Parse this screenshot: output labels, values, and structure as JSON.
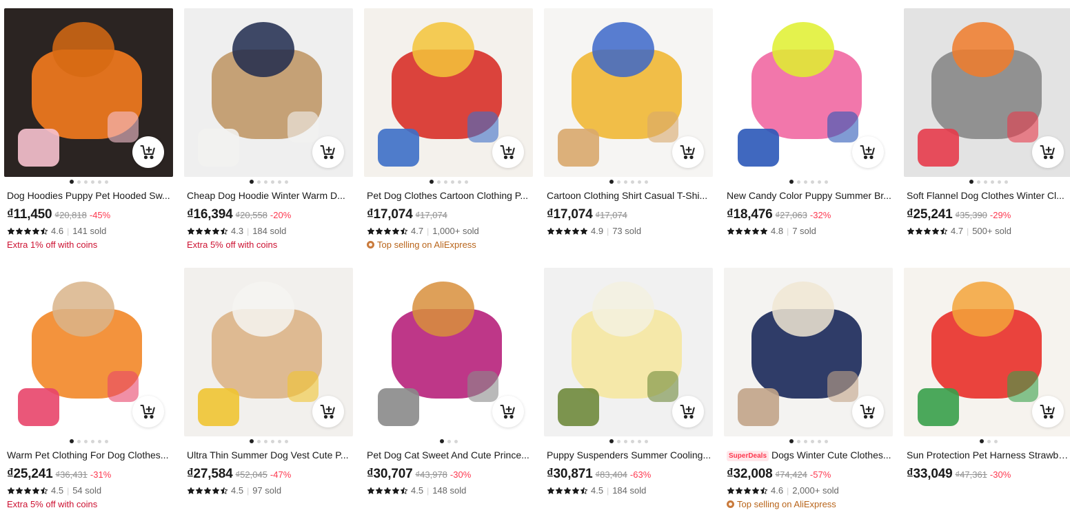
{
  "colors": {
    "price": "#191919",
    "discount": "#fd384f",
    "extra": "#cc1131",
    "top_selling": "#b8641a",
    "star": "#191919"
  },
  "products": [
    {
      "title": "Dog Hoodies Puppy Pet Hooded Sw...",
      "price": "₫11,450",
      "original_price": "₫20,818",
      "discount": "-45%",
      "rating": "4.6",
      "sold": "141 sold",
      "extra": "Extra 1% off with coins",
      "dots": 6,
      "image": {
        "bg": "#2b2422",
        "c1": "#f07a1e",
        "c2": "#d66a13",
        "c3": "#f7c2cf",
        "icon": "cart-add-icon"
      }
    },
    {
      "title": "Cheap Dog Hoodie Winter Warm D...",
      "price": "₫16,394",
      "original_price": "₫20,558",
      "discount": "-20%",
      "rating": "4.3",
      "sold": "184 sold",
      "extra": "Extra 5% off with coins",
      "dots": 6,
      "image": {
        "bg": "#efefef",
        "c1": "#c19a6b",
        "c2": "#1f2a4d",
        "c3": "#f2f2f0",
        "icon": "cart-add-icon"
      }
    },
    {
      "title": "Pet Dog Clothes Cartoon Clothing P...",
      "price": "₫17,074",
      "original_price": "₫17,074",
      "discount": "",
      "rating": "4.7",
      "sold": "1,000+ sold",
      "top_selling": "Top selling on AliExpress",
      "dots": 6,
      "image": {
        "bg": "#f4f1ec",
        "c1": "#d8342c",
        "c2": "#f3c43a",
        "c3": "#3d6fc8",
        "icon": "cart-add-icon"
      }
    },
    {
      "title": "Cartoon Clothing Shirt Casual T-Shi...",
      "price": "₫17,074",
      "original_price": "₫17,074",
      "discount": "",
      "rating": "4.9",
      "sold": "73 sold",
      "dots": 6,
      "image": {
        "bg": "#f6f5f3",
        "c1": "#f0b93a",
        "c2": "#3c67c9",
        "c3": "#d9a86d",
        "icon": "cart-add-icon"
      }
    },
    {
      "title": "New Candy Color Puppy Summer Br...",
      "price": "₫18,476",
      "original_price": "₫27,063",
      "discount": "-32%",
      "rating": "4.8",
      "sold": "7 sold",
      "dots": 6,
      "image": {
        "bg": "#ffffff",
        "c1": "#f16ba4",
        "c2": "#dff02e",
        "c3": "#2b58b8",
        "icon": "cart-add-icon"
      }
    },
    {
      "title": "Soft Flannel Dog Clothes Winter Cl...",
      "price": "₫25,241",
      "original_price": "₫35,390",
      "discount": "-29%",
      "rating": "4.7",
      "sold": "500+ sold",
      "dots": 6,
      "image": {
        "bg": "#e3e3e3",
        "c1": "#8a8a8a",
        "c2": "#f07b2a",
        "c3": "#e63b4b",
        "icon": "cart-add-icon"
      }
    },
    {
      "title": "Warm Pet Clothing For Dog Clothes...",
      "price": "₫25,241",
      "original_price": "₫36,431",
      "discount": "-31%",
      "rating": "4.5",
      "sold": "54 sold",
      "extra": "Extra 5% off with coins",
      "dots": 6,
      "image": {
        "bg": "#ffffff",
        "c1": "#f28a2c",
        "c2": "#d9b48a",
        "c3": "#e8456a",
        "icon": "cart-add-icon"
      }
    },
    {
      "title": "Ultra Thin Summer Dog Vest Cute P...",
      "price": "₫27,584",
      "original_price": "₫52,045",
      "discount": "-47%",
      "rating": "4.5",
      "sold": "97 sold",
      "dots": 6,
      "image": {
        "bg": "#f2f0ed",
        "c1": "#dcb58a",
        "c2": "#f6f4f1",
        "c3": "#f0c432",
        "icon": "cart-add-icon"
      }
    },
    {
      "title": "Pet Dog Cat Sweet And Cute Prince...",
      "price": "₫30,707",
      "original_price": "₫43,978",
      "discount": "-30%",
      "rating": "4.5",
      "sold": "148 sold",
      "dots": 3,
      "image": {
        "bg": "#ffffff",
        "c1": "#b8267e",
        "c2": "#d88f3c",
        "c3": "#8a8a8a",
        "icon": "cart-add-icon"
      }
    },
    {
      "title": "Puppy Suspenders Summer Cooling...",
      "price": "₫30,871",
      "original_price": "₫83,404",
      "discount": "-63%",
      "rating": "4.5",
      "sold": "184 sold",
      "dots": 6,
      "image": {
        "bg": "#f1f1f1",
        "c1": "#f5e7a3",
        "c2": "#f3f1e0",
        "c3": "#6f8a3c",
        "icon": "cart-add-icon"
      }
    },
    {
      "title": "Dogs Winter Cute Clothes...",
      "superdeals": "SuperDeals",
      "price": "₫32,008",
      "original_price": "₫74,424",
      "discount": "-57%",
      "rating": "4.6",
      "sold": "2,000+ sold",
      "top_selling": "Top selling on AliExpress",
      "dots": 6,
      "image": {
        "bg": "#f4f3f1",
        "c1": "#1d2c5c",
        "c2": "#f0e6d4",
        "c3": "#c2a488",
        "icon": "cart-add-icon"
      }
    },
    {
      "title": "Sun Protection Pet Harness Strawbe...",
      "price": "₫33,049",
      "original_price": "₫47,361",
      "discount": "-30%",
      "rating": "",
      "sold": "",
      "dots": 3,
      "image": {
        "bg": "#f6f3ee",
        "c1": "#e8342e",
        "c2": "#f3a33a",
        "c3": "#39a04a",
        "icon": "cart-add-icon"
      }
    }
  ]
}
